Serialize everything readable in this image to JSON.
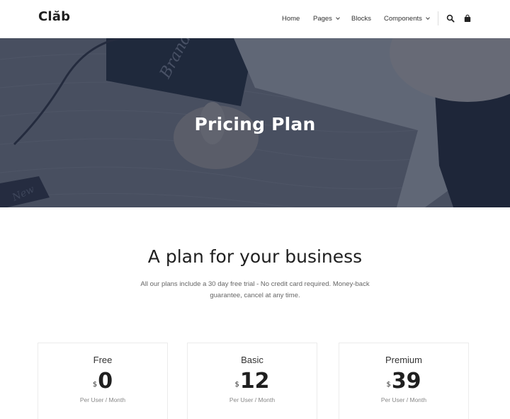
{
  "brand": {
    "logo": "Clăb"
  },
  "nav": {
    "items": [
      {
        "label": "Home",
        "has_dropdown": false
      },
      {
        "label": "Pages",
        "has_dropdown": true
      },
      {
        "label": "Blocks",
        "has_dropdown": false
      },
      {
        "label": "Components",
        "has_dropdown": true
      }
    ],
    "icons": [
      "search-icon",
      "shopping-bag-icon"
    ]
  },
  "hero": {
    "title": "Pricing Plan",
    "overlay_color": "#20283e"
  },
  "section": {
    "title": "A plan for your business",
    "description": "All our plans include a 30 day free trial - No credit card required. Money-back guarantee, cancel at any time."
  },
  "plans": [
    {
      "name": "Free",
      "currency": "$",
      "price": "0",
      "period": "Per User / Month"
    },
    {
      "name": "Basic",
      "currency": "$",
      "price": "12",
      "period": "Per User / Month"
    },
    {
      "name": "Premium",
      "currency": "$",
      "price": "39",
      "period": "Per User / Month"
    }
  ]
}
